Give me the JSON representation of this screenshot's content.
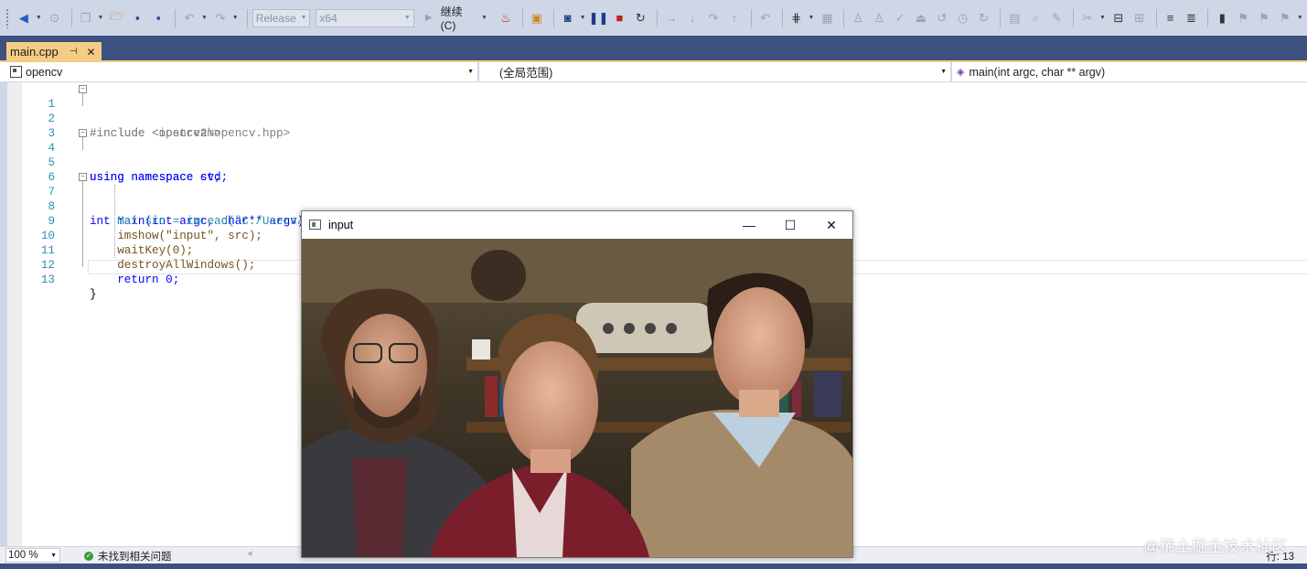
{
  "toolbar": {
    "configuration": "Release",
    "platform": "x64",
    "continue_label": "继续(C)",
    "icons": [
      "back-icon",
      "forward-icon",
      "new-item-icon",
      "open-folder-icon",
      "save-icon",
      "save-all-icon",
      "undo-icon",
      "redo-icon",
      "hot-reload-icon",
      "solution-explorer-icon",
      "screenshot-icon",
      "pause-icon",
      "stop-icon",
      "restart-icon",
      "show-next-statement-icon",
      "step-into-icon",
      "step-over-icon",
      "step-out-icon",
      "comment-icon",
      "bookmark-icon"
    ]
  },
  "tab": {
    "label": "main.cpp",
    "pin": "⊣",
    "close": "✕"
  },
  "navbar": {
    "project": "opencv",
    "scope": "(全局范围)",
    "member": "main(int argc, char ** argv)"
  },
  "code": {
    "line_numbers": [
      "1",
      "2",
      "3",
      "4",
      "5",
      "6",
      "7",
      "8",
      "9",
      "10",
      "11",
      "12",
      "13"
    ],
    "lines": [
      "#include <opencv2\\opencv.hpp>",
      "#include <iostream>",
      "",
      "using namespace cv;",
      "using namespace std;",
      "",
      "int main(int argc, char** argv) {",
      "    Mat src = imread(\"C:/Users/Dell/Pictures/faces.jpg\");",
      "    imshow(\"input\", src);",
      "    waitKey(0);",
      "    destroyAllWindows();",
      "    return 0;",
      "}"
    ]
  },
  "image_window": {
    "title": "input",
    "minimize": "—",
    "maximize": "☐",
    "close": "✕"
  },
  "statusbar": {
    "zoom": "100 %",
    "issues": "未找到相关问题",
    "row": "行: 13"
  },
  "watermark": "@稀土掘金技术社区",
  "colors": {
    "chrome": "#cfd6e5",
    "tab_active": "#f5cc84",
    "tabbar": "#3d5180",
    "keyword": "#0000ff",
    "string": "#a31515",
    "line_number": "#2b91af"
  }
}
